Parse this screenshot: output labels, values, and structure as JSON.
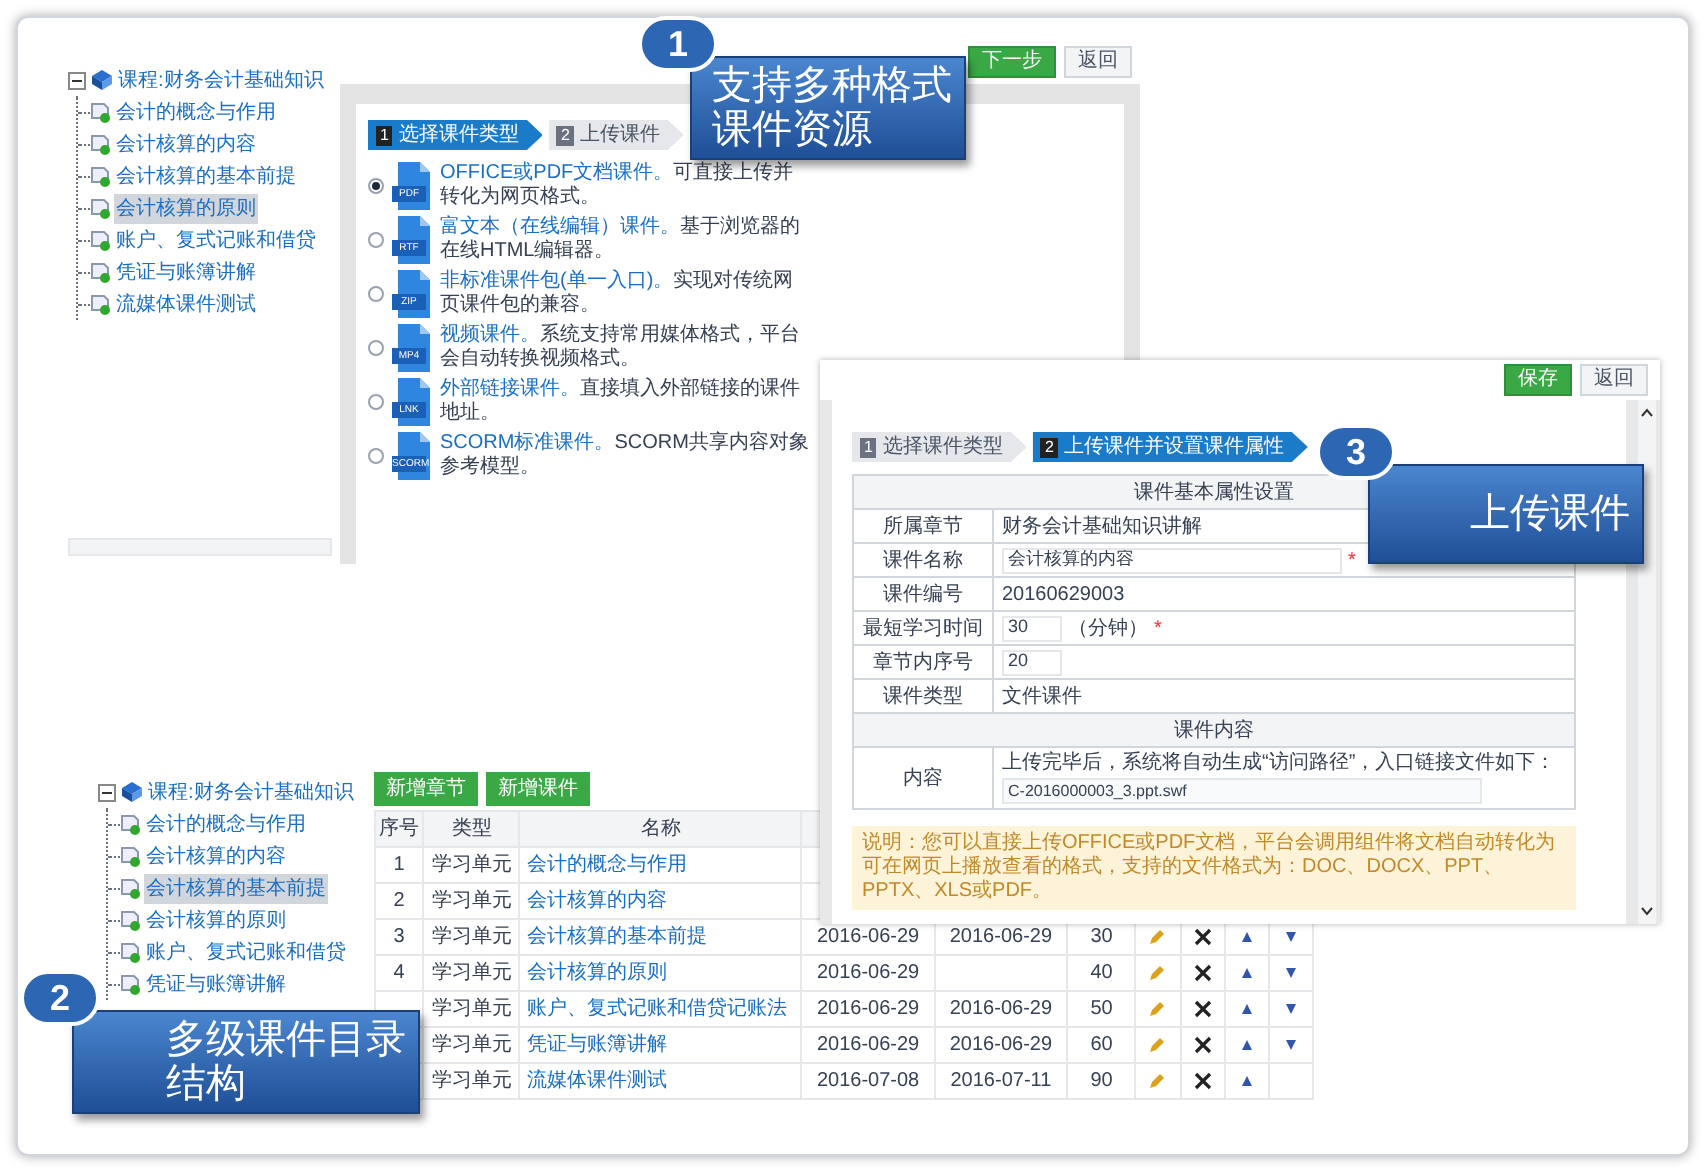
{
  "window_course_types": {
    "tree": {
      "root": "课程:财务会计基础知识",
      "expanded": true,
      "children": [
        {
          "label": "会计的概念与作用",
          "selected": false
        },
        {
          "label": "会计核算的内容",
          "selected": false
        },
        {
          "label": "会计核算的基本前提",
          "selected": false
        },
        {
          "label": "会计核算的原则",
          "selected": true
        },
        {
          "label": "账户、复式记账和借贷",
          "selected": false
        },
        {
          "label": "凭证与账簿讲解",
          "selected": false
        },
        {
          "label": "流媒体课件测试",
          "selected": false
        }
      ]
    },
    "toolbar_buttons": [
      {
        "label": "下一步",
        "kind": "primary"
      },
      {
        "label": "返回",
        "kind": "plain"
      }
    ],
    "steps": [
      {
        "number": "1",
        "label": "选择课件类型",
        "selected": true
      },
      {
        "number": "2",
        "label": "上传课件",
        "selected": false
      }
    ],
    "options": [
      {
        "badge": "PDF",
        "title": "OFFICE或PDF文档课件。",
        "description": "可直接上传并转化为网页格式。",
        "selected": true
      },
      {
        "badge": "RTF",
        "title": "富文本（在线编辑）课件。",
        "description": "基于浏览器的在线HTML编辑器。",
        "selected": false
      },
      {
        "badge": "ZIP",
        "title": "非标准课件包(单一入口)。",
        "description": "实现对传统网页课件包的兼容。",
        "selected": false
      },
      {
        "badge": "MP4",
        "title": "视频课件。",
        "description": "系统支持常用媒体格式，平台会自动转换视频格式。",
        "selected": false
      },
      {
        "badge": "LNK",
        "title": "外部链接课件。",
        "description": "直接填入外部链接的课件地址。",
        "selected": false
      },
      {
        "badge": "SCORM",
        "title": "SCORM标准课件。",
        "description": "SCORM共享内容对象参考模型。",
        "selected": false
      }
    ]
  },
  "window_course_form": {
    "toolbar_buttons": [
      {
        "label": "保存",
        "kind": "primary"
      },
      {
        "label": "返回",
        "kind": "plain"
      }
    ],
    "steps": [
      {
        "number": "1",
        "label": "选择课件类型",
        "selected": false
      },
      {
        "number": "2",
        "label": "上传课件并设置课件属性",
        "selected": true
      }
    ],
    "rows": [
      {
        "kind": "section",
        "label": "课件基本属性设置"
      },
      {
        "kind": "text",
        "label": "所属章节",
        "value": "财务会计基础知识讲解"
      },
      {
        "kind": "input",
        "label": "课件名称",
        "value": "会计核算的内容",
        "required_mark": "*"
      },
      {
        "kind": "text",
        "label": "课件编号",
        "value": "20160629003"
      },
      {
        "kind": "input",
        "label": "最短学习时间",
        "value": "30",
        "suffix": "（分钟）",
        "required_mark": "*"
      },
      {
        "kind": "input",
        "label": "章节内序号",
        "value": "20"
      },
      {
        "kind": "text",
        "label": "课件类型",
        "value": "文件课件"
      },
      {
        "kind": "section",
        "label": "课件内容"
      },
      {
        "kind": "content",
        "label": "内容",
        "text": "上传完毕后，系统将自动生成“访问路径”，入口链接文件如下：",
        "file_path": "C-2016000003_3.ppt.swf"
      }
    ],
    "notice": "说明：您可以直接上传OFFICE或PDF文档，平台会调用组件将文档自动转化为可在网页上播放查看的格式，支持的文件格式为：DOC、DOCX、PPT、PPTX、XLS或PDF。"
  },
  "window_course_list": {
    "tree": {
      "root": "课程:财务会计基础知识",
      "expanded": true,
      "children": [
        {
          "label": "会计的概念与作用",
          "selected": false
        },
        {
          "label": "会计核算的内容",
          "selected": false
        },
        {
          "label": "会计核算的基本前提",
          "selected": true
        },
        {
          "label": "会计核算的原则",
          "selected": false
        },
        {
          "label": "账户、复式记账和借贷",
          "selected": false
        },
        {
          "label": "凭证与账簿讲解",
          "selected": false
        }
      ]
    },
    "buttons": [
      "新增章节",
      "新增课件"
    ],
    "columns": [
      "序号",
      "类型",
      "名称"
    ],
    "rows": [
      {
        "seq": "1",
        "type": "学习单元",
        "name": "会计的概念与作用"
      },
      {
        "seq": "2",
        "type": "学习单元",
        "name": "会计核算的内容"
      },
      {
        "seq": "3",
        "type": "学习单元",
        "name": "会计核算的基本前提",
        "start": "2016-06-29",
        "end": "2016-06-29",
        "order": "30",
        "can_move_down": true
      },
      {
        "seq": "4",
        "type": "学习单元",
        "name": "会计核算的原则",
        "start": "2016-06-29",
        "order": "40",
        "can_move_down": true
      },
      {
        "type": "学习单元",
        "name": "账户、复式记账和借贷记账法",
        "start": "2016-06-29",
        "end": "2016-06-29",
        "order": "50",
        "can_move_down": true
      },
      {
        "type": "学习单元",
        "name": "凭证与账簿讲解",
        "start": "2016-06-29",
        "end": "2016-06-29",
        "order": "60",
        "can_move_down": true
      },
      {
        "type": "学习单元",
        "name": "流媒体课件测试",
        "start": "2016-07-08",
        "end": "2016-07-11",
        "order": "90",
        "can_move_down": false
      }
    ]
  },
  "callouts": [
    {
      "number": "1",
      "lines": [
        "支持多种格式",
        "课件资源"
      ]
    },
    {
      "number": "3",
      "lines": [
        "上传课件"
      ]
    },
    {
      "number": "2",
      "lines": [
        "多级课件目录",
        "结构"
      ]
    }
  ]
}
